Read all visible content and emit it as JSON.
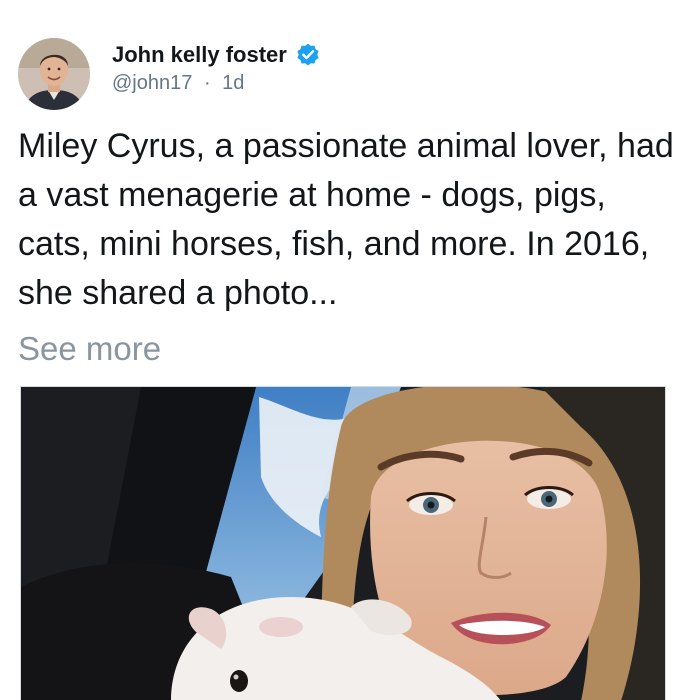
{
  "post": {
    "author": {
      "display_name": "John kelly foster",
      "handle": "@john17",
      "separator": "·",
      "timestamp": "1d",
      "verified": true,
      "avatar_icon": "user-avatar-photo"
    },
    "text": "Miley Cyrus, a passionate animal lover, had a vast menagerie at home - dogs, pigs, cats, mini horses, fish, and more. In 2016, she shared a photo...",
    "see_more_label": "See more",
    "media": {
      "type": "photo",
      "icon": "photo-selfie-with-dog"
    }
  },
  "colors": {
    "verified_badge": "#1da1f2",
    "secondary_text": "#657786",
    "see_more": "#8a959f"
  }
}
